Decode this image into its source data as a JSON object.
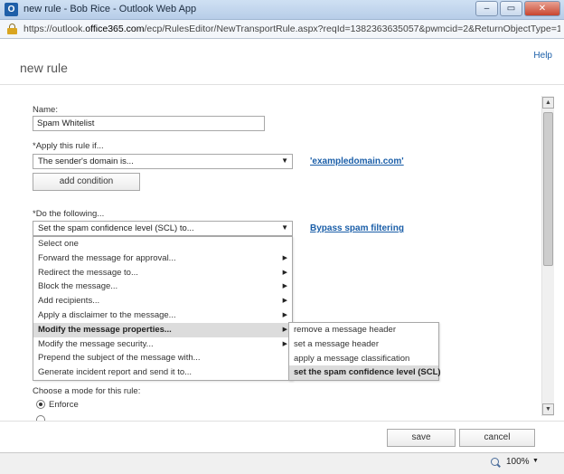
{
  "window": {
    "title": "new rule - Bob Rice - Outlook Web App",
    "app_icon_letter": "O",
    "minimize_glyph": "–",
    "maximize_glyph": "▭",
    "close_glyph": "✕"
  },
  "address": {
    "prefix": "https://outlook.",
    "domain": "office365.com",
    "path": "/ecp/RulesEditor/NewTransportRule.aspx?reqId=1382363635057&pwmcid=2&ReturnObjectType=1&configIc"
  },
  "page": {
    "title": "new rule",
    "help": "Help"
  },
  "form": {
    "name_label": "Name:",
    "name_value": "Spam Whitelist",
    "apply_label": "*Apply this rule if...",
    "condition_value": "The sender's domain is...",
    "condition_link": "'exampledomain.com'",
    "add_condition": "add condition",
    "do_label": "*Do the following...",
    "action_value": "Set the spam confidence level (SCL) to...",
    "action_link": "Bypass spam filtering",
    "mode_label": "Choose a mode for this rule:",
    "mode_enforce": "Enforce"
  },
  "action_menu": {
    "items": [
      {
        "label": "Select one",
        "has_sub": false
      },
      {
        "label": "Forward the message for approval...",
        "has_sub": true
      },
      {
        "label": "Redirect the message to...",
        "has_sub": true
      },
      {
        "label": "Block the message...",
        "has_sub": true
      },
      {
        "label": "Add recipients...",
        "has_sub": true
      },
      {
        "label": "Apply a disclaimer to the message...",
        "has_sub": true
      },
      {
        "label": "Modify the message properties...",
        "has_sub": true,
        "highlighted": true
      },
      {
        "label": "Modify the message security...",
        "has_sub": true
      },
      {
        "label": "Prepend the subject of the message with...",
        "has_sub": false
      },
      {
        "label": "Generate incident report and send it to...",
        "has_sub": false
      }
    ]
  },
  "submenu": {
    "items": [
      {
        "label": "remove a message header"
      },
      {
        "label": "set a message header"
      },
      {
        "label": "apply a message classification"
      },
      {
        "label": "set the spam confidence level (SCL)",
        "highlighted": true
      }
    ]
  },
  "buttons": {
    "save": "save",
    "cancel": "cancel"
  },
  "status": {
    "zoom": "100%"
  }
}
